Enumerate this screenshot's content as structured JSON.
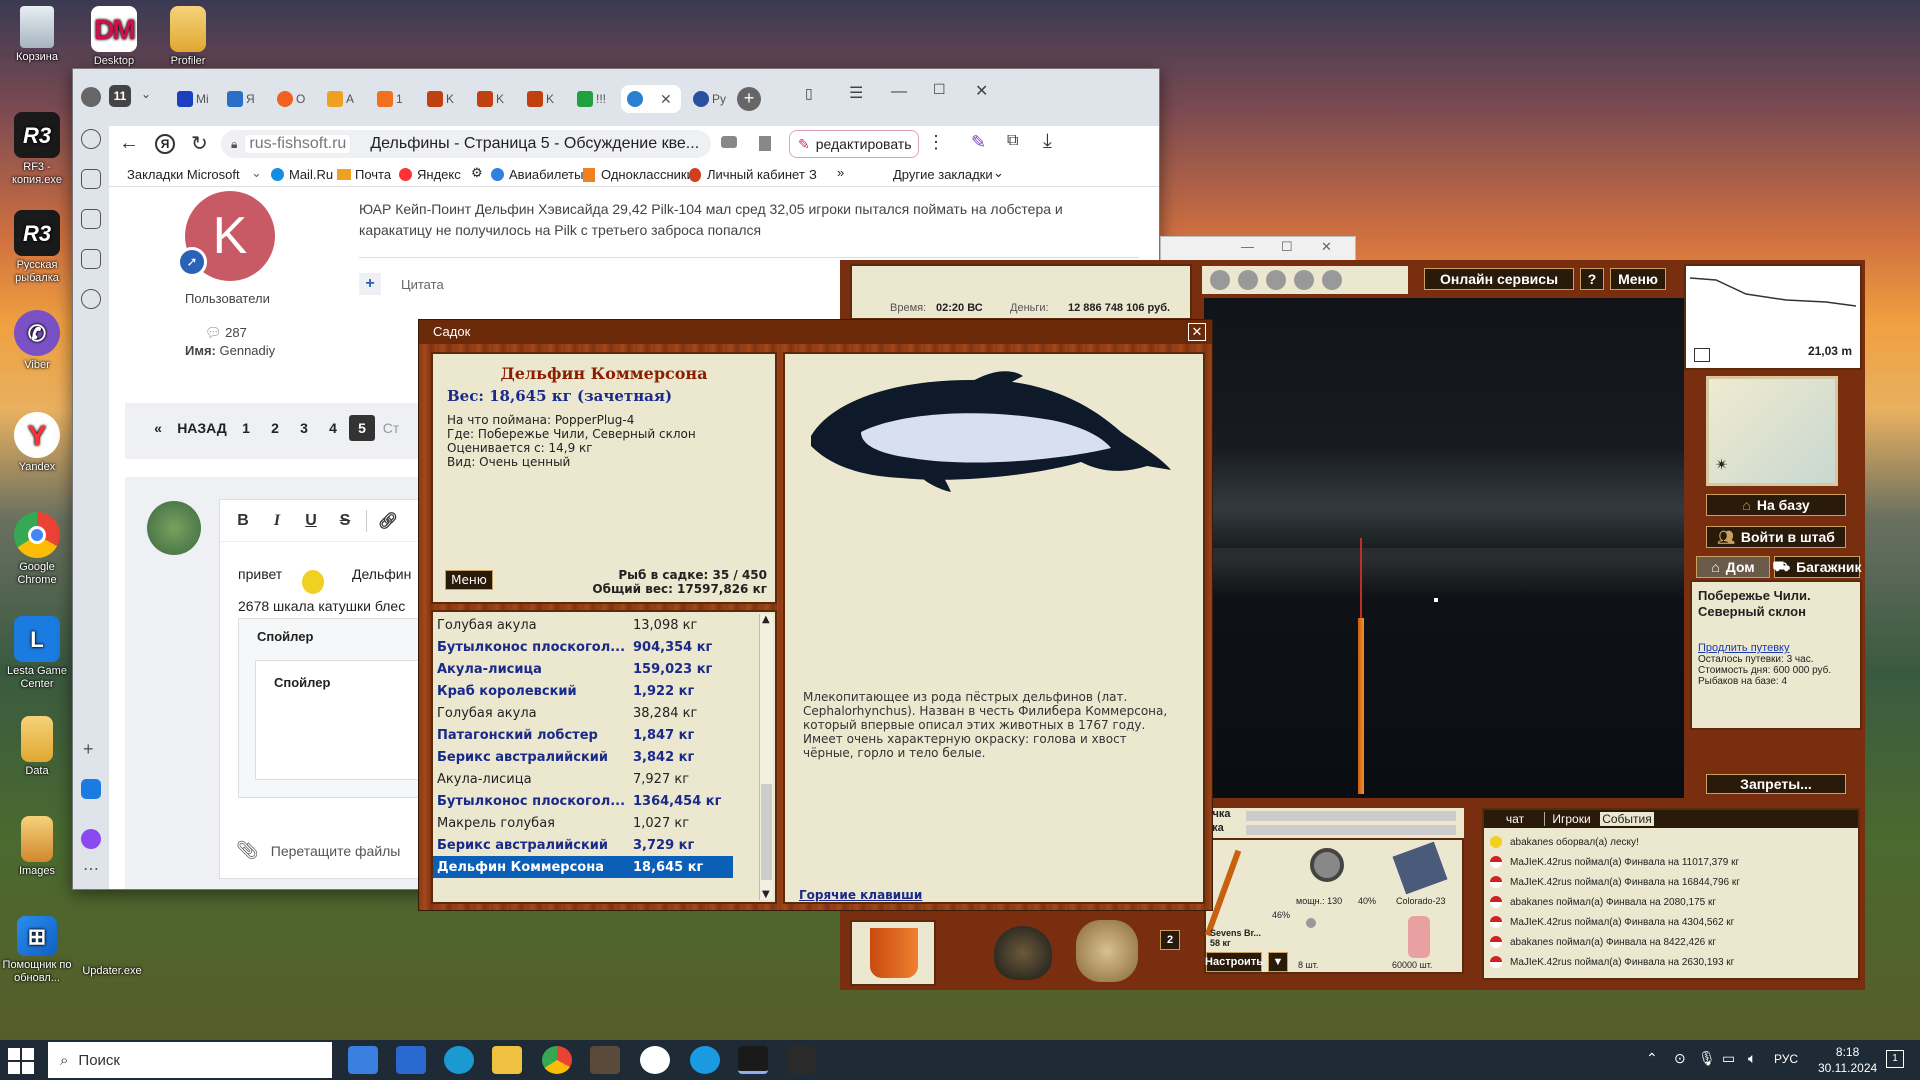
{
  "desktop": {
    "icons": [
      {
        "label": "Корзина"
      },
      {
        "label": "Desktop"
      },
      {
        "label": "Profiler"
      },
      {
        "label": "RF3 - копия.exe"
      },
      {
        "label": "Русская рыбалка"
      },
      {
        "label": "Viber"
      },
      {
        "label": "Yandex"
      },
      {
        "label": "Google Chrome"
      },
      {
        "label": "Lesta Game Center"
      },
      {
        "label": "Data"
      },
      {
        "label": "Images"
      },
      {
        "label": "Помощник по обновл..."
      },
      {
        "label": "Updater.exe"
      }
    ]
  },
  "browser": {
    "tab_count_badge": "11",
    "tabs": [
      "Mi",
      "Я",
      "O",
      "A",
      "1",
      "K",
      "K",
      "K",
      "!!!",
      "",
      "Py"
    ],
    "address_domain": "rus-fishsoft.ru",
    "page_title": "Дельфины - Страница 5 - Обсуждение кве...",
    "edit_button": "редактировать",
    "bookmarks": [
      "Закладки Microsoft",
      "Mail.Ru",
      "Почта",
      "Яндекс",
      "Авиабилеты",
      "Одноклассники",
      "Личный кабинет",
      "З"
    ],
    "other_bookmarks": "Другие закладки",
    "post": {
      "avatar_letter": "K",
      "role": "Пользователи",
      "posts_count": "287",
      "name_label": "Имя:",
      "name_value": "Gennadiy",
      "text": "ЮАР Кейп-Поинт Дельфин Хэвисайда 29,42 Pilk-104 мал сред 32,05 игроки пытался поймать на лобстера  и каракатицу не получилось на Pilk с третьего заброса попался",
      "quote": "Цитата"
    },
    "pagination": {
      "prev": "«",
      "back": "НАЗАД",
      "pages": [
        "1",
        "2",
        "3",
        "4",
        "5"
      ],
      "current": "5",
      "more": "Ст"
    },
    "editor": {
      "buttons": [
        "B",
        "I",
        "U",
        "S"
      ],
      "line1": "привет",
      "line1b": "Дельфин",
      "line2": "2678 шкала катушки блес",
      "spoiler1": "Спойлер",
      "spoiler2": "Спойлер",
      "attach": "Перетащите файлы"
    }
  },
  "game": {
    "time_label": "Время:",
    "time_value": "02:20 ВС",
    "money_label": "Деньги:",
    "money_value": "12 886 748 106 руб.",
    "online_services": "Онлайн сервисы",
    "help": "?",
    "menu": "Меню",
    "depth": "21,03 m",
    "to_base": "На базу",
    "enter_hq": "Войти в штаб",
    "home_tab": "Дом",
    "trunk_tab": "Багажник",
    "location": "Побережье Чили. Северный склон",
    "extend_trip": "Продлить путевку",
    "trip_info": [
      "Осталось путевки: 3 час.",
      "Стоимость дня: 600 000 руб.",
      "Рыбаков на базе: 4"
    ],
    "bans": "Запреты...",
    "gauge_labels": [
      "очка",
      "ска"
    ],
    "tackle": {
      "rod_name": "Sevens Br...",
      "rod_weight": "58 кг",
      "rod_pct": "46%",
      "reel_power": "мощн.: 130",
      "reel_pct": "40%",
      "line_name": "Colorado-23",
      "hook_count": "8 шт.",
      "bait_count": "60000 шт.",
      "configure": "Настроить",
      "slot_number": "2"
    },
    "chat_tabs": [
      "чат",
      "Игроки",
      "События"
    ],
    "events": [
      "abakanes оборвал(а) леску!",
      "MaJIeK.42rus поймал(а) Финвала на 11017,379 кг",
      "MaJIeK.42rus поймал(а) Финвала на 16844,796 кг",
      "abakanes поймал(а) Финвала на 2080,175 кг",
      "MaJIeK.42rus поймал(а) Финвала на 4304,562 кг",
      "abakanes поймал(а) Финвала на 8422,426 кг",
      "MaJIeK.42rus поймал(а) Финвала на 2630,193 кг"
    ]
  },
  "sadok": {
    "window_title": "Садок",
    "fish_name": "Дельфин Коммерсона",
    "weight_line": "Вес: 18,645 кг (зачетная)",
    "caught_on": "На что поймана: PopperPlug-4",
    "where": "Где: Побережье Чили, Северный склон",
    "valued_from": "Оценивается с: 14,9 кг",
    "kind": "Вид: Очень ценный",
    "menu": "Меню",
    "fish_count": "Рыб в садке: 35 / 450",
    "total_weight": "Общий вес: 17597,826 кг",
    "description": "Млекопитающее из рода пёстрых дельфинов (лат. Cephalorhynchus). Назван в честь Филибера Коммерсона, который впервые описал этих животных в 1767 году. Имеет очень характерную окраску: голова и хвост чёрные, горло и тело белые.",
    "hotkeys": "Горячие клавиши",
    "fish_list": [
      {
        "name": "Голубая акула",
        "weight": "13,098 кг",
        "trophy": false
      },
      {
        "name": "Бутылконос плоскогол...",
        "weight": "904,354 кг",
        "trophy": true
      },
      {
        "name": "Акула-лисица",
        "weight": "159,023 кг",
        "trophy": true
      },
      {
        "name": "Краб королевский",
        "weight": "1,922 кг",
        "trophy": true
      },
      {
        "name": "Голубая акула",
        "weight": "38,284 кг",
        "trophy": false
      },
      {
        "name": "Патагонский лобстер",
        "weight": "1,847 кг",
        "trophy": true
      },
      {
        "name": "Берикс австралийский",
        "weight": "3,842 кг",
        "trophy": true
      },
      {
        "name": "Акула-лисица",
        "weight": "7,927 кг",
        "trophy": false
      },
      {
        "name": "Бутылконос плоскогол...",
        "weight": "1364,454 кг",
        "trophy": true
      },
      {
        "name": "Макрель голубая",
        "weight": "1,027 кг",
        "trophy": false
      },
      {
        "name": "Берикс австралийский",
        "weight": "3,729 кг",
        "trophy": true
      },
      {
        "name": "Дельфин Коммерсона",
        "weight": "18,645 кг",
        "trophy": true,
        "selected": true
      }
    ]
  },
  "taskbar": {
    "search": "Поиск",
    "lang": "РУС",
    "time": "8:18",
    "date": "30.11.2024",
    "notifications": "1"
  }
}
